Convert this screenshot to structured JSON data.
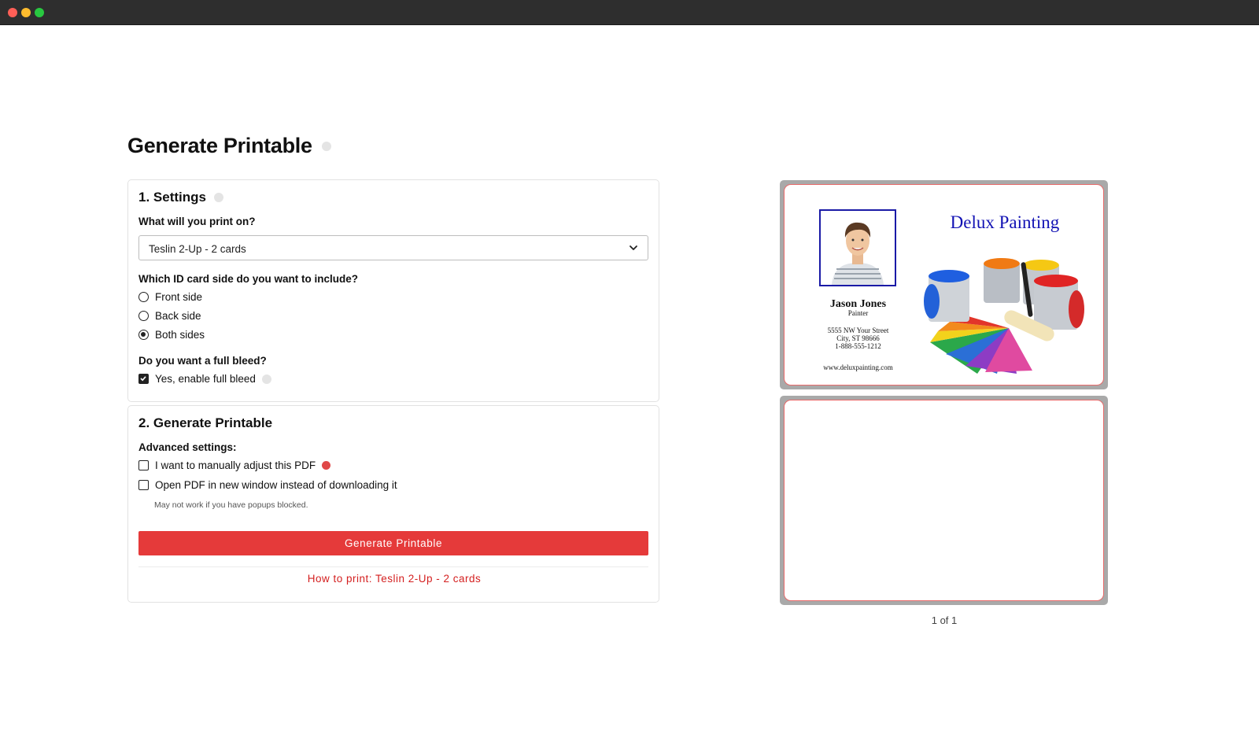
{
  "window": {
    "colors": {
      "close": "#ff5f57",
      "minimize": "#febc2e",
      "zoom": "#28c840"
    }
  },
  "page_title": "Generate Printable",
  "settings": {
    "title": "1. Settings",
    "print_on_label": "What will you print on?",
    "print_on_value": "Teslin 2-Up - 2 cards",
    "side_question": "Which ID card side do you want to include?",
    "side_options": [
      {
        "label": "Front side",
        "checked": false
      },
      {
        "label": "Back side",
        "checked": false
      },
      {
        "label": "Both sides",
        "checked": true
      }
    ],
    "bleed_question": "Do you want a full bleed?",
    "bleed_option": {
      "label": "Yes, enable full bleed",
      "checked": true
    }
  },
  "generate": {
    "title": "2. Generate Printable",
    "advanced_label": "Advanced settings:",
    "manual_adjust": {
      "label": "I want to manually adjust this PDF",
      "checked": false
    },
    "open_new_window": {
      "label": "Open PDF in new window instead of downloading it",
      "checked": false
    },
    "popup_hint": "May not work if you have popups blocked.",
    "button_label": "Generate Printable",
    "how_to_link": "How to print: Teslin 2-Up - 2 cards",
    "accent_color": "#e53a3a"
  },
  "preview": {
    "front_card": {
      "company": "Delux Painting",
      "name": "Jason Jones",
      "role": "Painter",
      "address_line1": "5555 NW Your Street",
      "address_line2": "City, ST 98666",
      "phone": "1-888-555-1212",
      "website": "www.deluxpainting.com"
    },
    "pager": "1 of 1"
  }
}
